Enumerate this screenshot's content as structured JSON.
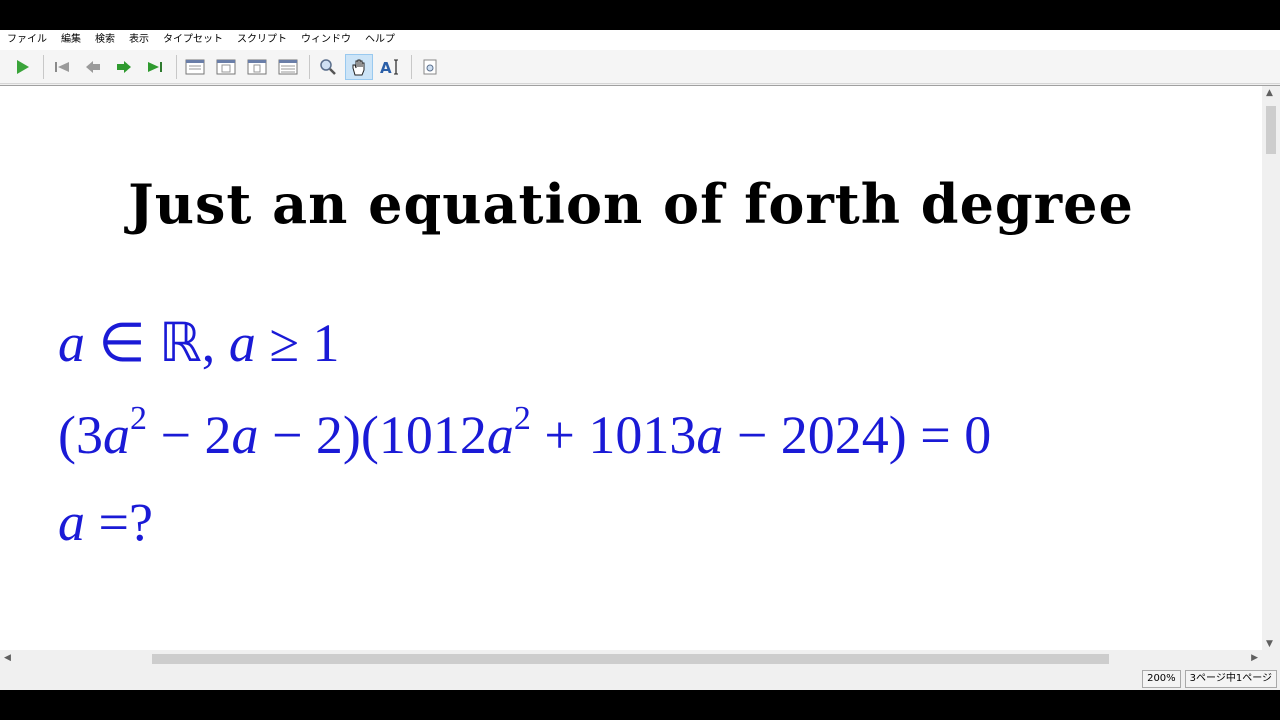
{
  "menu": [
    "ファイル",
    "編集",
    "検索",
    "表示",
    "タイプセット",
    "スクリプト",
    "ウィンドウ",
    "ヘルプ"
  ],
  "toolbar": {
    "buttons": [
      "typeset-icon",
      "first-page-icon",
      "previous-page-icon",
      "next-page-icon",
      "last-page-icon",
      "page-view-icon",
      "page-view-2-icon",
      "page-view-3-icon",
      "page-view-4-icon",
      "magnifier-icon",
      "hand-tool-icon",
      "text-select-icon",
      "find-icon"
    ],
    "active": "hand-tool-icon"
  },
  "document": {
    "title": "Just an equation of forth degree",
    "line1": {
      "a": "a",
      "in": " ∈ ℝ, ",
      "a2": "a",
      "rest": " ≥ 1"
    },
    "line2": {
      "p1": "(3",
      "v1": "a",
      "e1": "2",
      "p2": " − 2",
      "v2": "a",
      "p3": " − 2)(1012",
      "v3": "a",
      "e2": "2",
      "p4": " + 1013",
      "v4": "a",
      "p5": " − 2024) = 0"
    },
    "line3": {
      "a": "a",
      "rest": " =?"
    }
  },
  "status": {
    "zoom": "200%",
    "page": "3ページ中1ページ"
  },
  "colors": {
    "math": "#1a1ad6",
    "typeset_green": "#3aa43a",
    "nav_green": "#2f9a2f"
  }
}
